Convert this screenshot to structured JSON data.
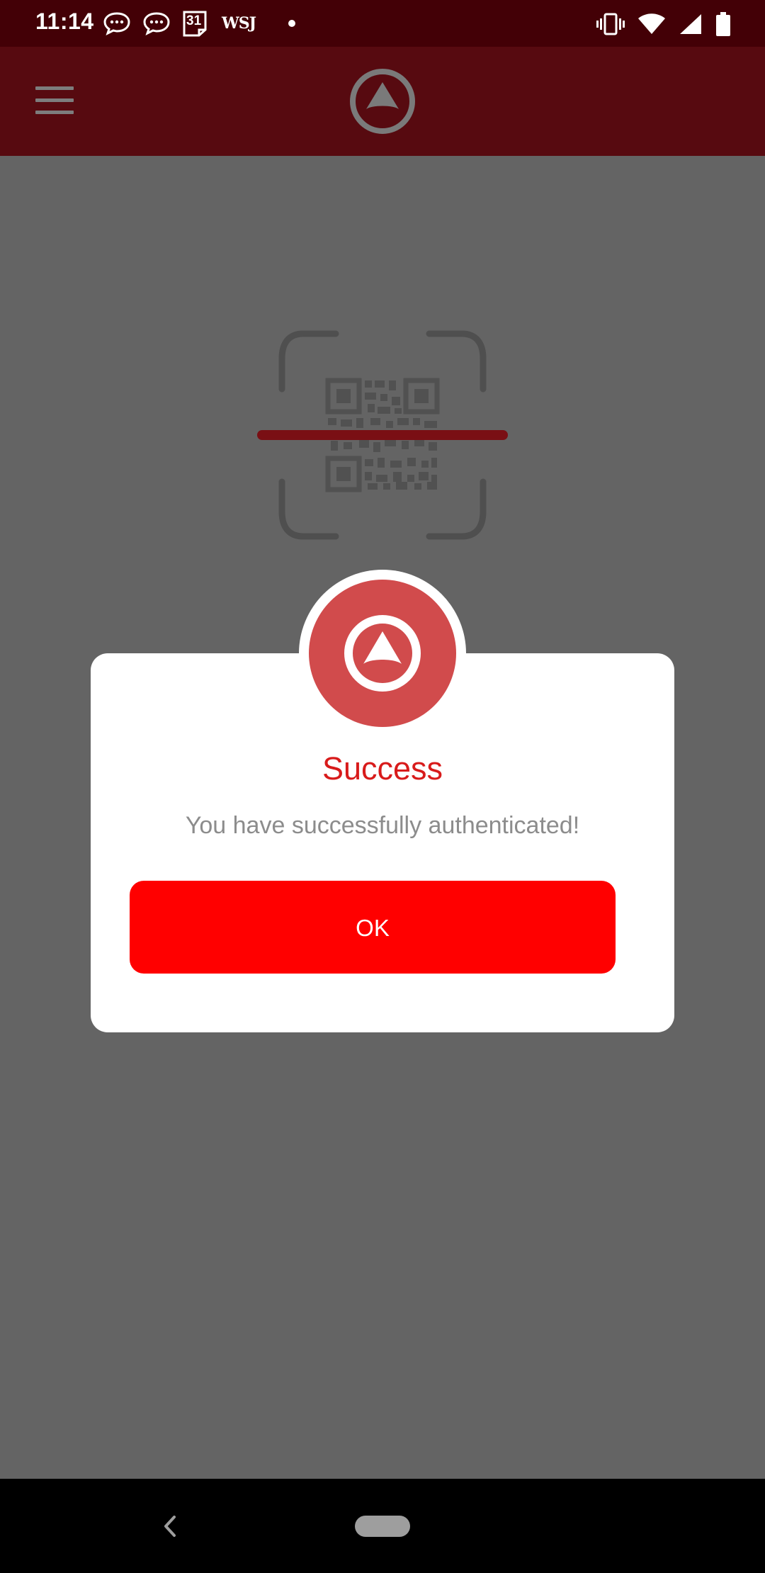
{
  "status_bar": {
    "time": "11:14",
    "icons_left": [
      "chat-bubble-icon",
      "chat-bubble-icon",
      "calendar-icon",
      "wsj-icon",
      "notification-dot-icon"
    ],
    "calendar_day": "31",
    "wsj_label": "WSJ",
    "icons_right": [
      "vibrate-icon",
      "wifi-icon",
      "cell-signal-icon",
      "battery-icon"
    ]
  },
  "app_bar": {
    "menu_icon": "hamburger-menu-icon",
    "logo_icon": "app-logo-icon"
  },
  "scanner": {
    "icon": "qr-code-scan-icon"
  },
  "dialog": {
    "badge_icon": "app-logo-icon",
    "title": "Success",
    "message": "You have successfully authenticated!",
    "ok_label": "OK"
  },
  "colors": {
    "status_bar_bg": "#430006",
    "app_bar_bg": "#570a10",
    "overlay_bg": "#646464",
    "badge_red": "#d14b4c",
    "title_red": "#d81b1b",
    "button_red": "#ff0000",
    "scan_line": "#7a0f14"
  },
  "nav_bar": {
    "back_icon": "back-chevron-icon",
    "home_icon": "home-pill-icon"
  }
}
